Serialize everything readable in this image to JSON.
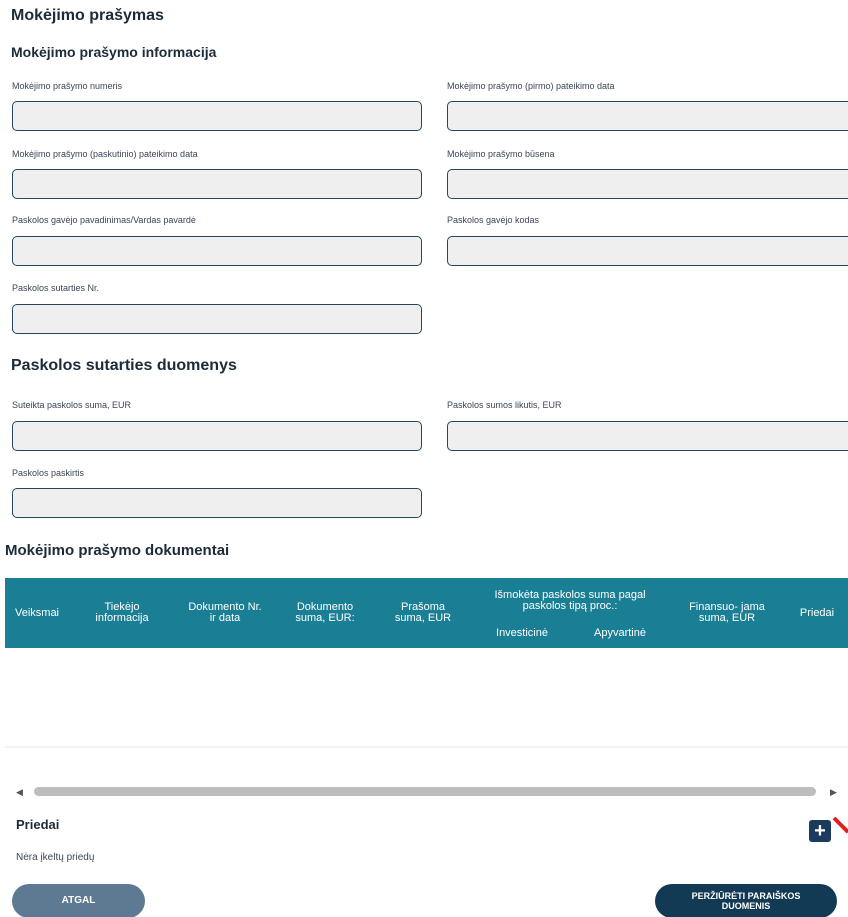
{
  "page": {
    "title": "Mokėjimo prašymas"
  },
  "info_section": {
    "title": "Mokėjimo prašymo informacija",
    "fields": {
      "request_number": {
        "label": "Mokėjimo prašymo numeris",
        "value": ""
      },
      "first_submit_date": {
        "label": "Mokėjimo prašymo (pirmo) pateikimo data",
        "value": ""
      },
      "last_submit_date": {
        "label": "Mokėjimo prašymo (paskutinio) pateikimo data",
        "value": ""
      },
      "status": {
        "label": "Mokėjimo prašymo būsena",
        "value": ""
      },
      "borrower_name": {
        "label": "Paskolos gavėjo pavadinimas/Vardas pavardė",
        "value": ""
      },
      "borrower_code": {
        "label": "Paskolos gavėjo kodas",
        "value": ""
      },
      "contract_number": {
        "label": "Paskolos sutarties Nr.",
        "value": ""
      }
    }
  },
  "contract_section": {
    "title": "Paskolos sutarties duomenys",
    "fields": {
      "loan_amount": {
        "label": "Suteikta paskolos suma, EUR",
        "value": ""
      },
      "loan_balance": {
        "label": "Paskolos sumos likutis, EUR",
        "value": ""
      },
      "loan_purpose": {
        "label": "Paskolos paskirtis",
        "value": ""
      }
    }
  },
  "documents_section": {
    "title": "Mokėjimo prašymo dokumentai",
    "columns": {
      "actions": "Veiksmai",
      "supplier": [
        "Tiekėjo",
        "informacija"
      ],
      "doc_no": [
        "Dokumento Nr.",
        "ir data"
      ],
      "doc_sum": [
        "Dokumento",
        "suma, EUR:"
      ],
      "requested": [
        "Prašoma",
        "suma, EUR"
      ],
      "paid_group": [
        "Išmokėta paskolos suma pagal",
        "paskolos tipą proc.:"
      ],
      "investment": "Investicinė",
      "working": "Apyvartinė",
      "financed": [
        "Finansuo- jama",
        "suma, EUR"
      ],
      "attachments": "Priedai"
    },
    "rows": []
  },
  "attachments": {
    "title": "Priedai",
    "empty_text": "Nėra įkeltų priedų"
  },
  "buttons": {
    "back": "ATGAL",
    "view_application": [
      "PERŽIŪRĖTI PARAIŠKOS",
      "DUOMENIS"
    ]
  },
  "icons": {
    "add": "plus-icon",
    "scroll_left": "scroll-left-arrow-icon",
    "scroll_right": "scroll-right-arrow-icon"
  },
  "colors": {
    "table_header": "#1a7f94",
    "input_border": "#24475f",
    "input_bg": "#efefef",
    "button_back": "#5e7a93",
    "button_primary": "#123a55"
  }
}
